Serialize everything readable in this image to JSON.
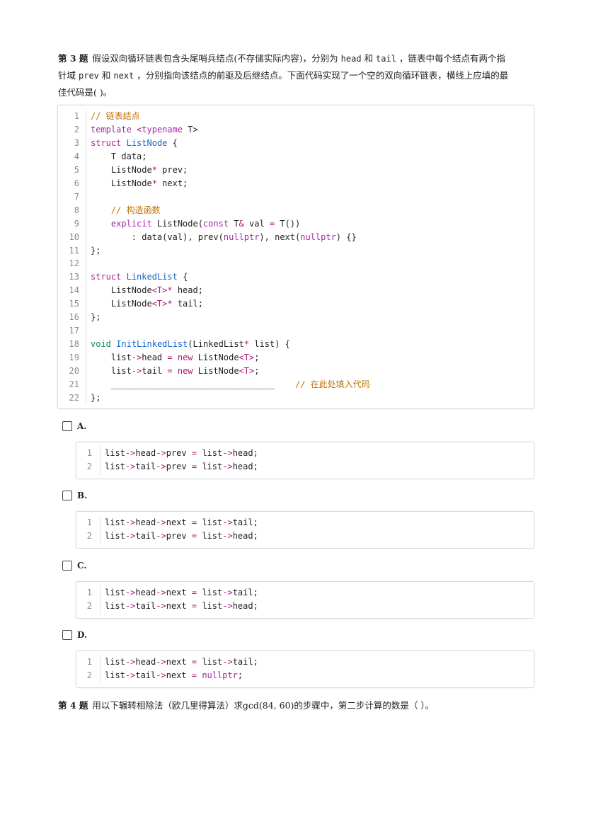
{
  "q3": {
    "num": "第 3 题",
    "line1_a": "假设双向循环链表包含头尾哨兵结点(不存储实际内容)，分别为",
    "line1_head": "head",
    "line1_and": "和",
    "line1_tail": "tail",
    "line1_b": "，链表中每个结点有两个指",
    "line2_a": "针域",
    "line2_prev": "prev",
    "line2_and": "和",
    "line2_next": "next",
    "line2_b": "，分别指向该结点的前驱及后继结点。下面代码实现了一个空的双向循环链表，横线上应填的最",
    "line3": "佳代码是( )。"
  },
  "main_code": {
    "line_numbers": [
      "1",
      "2",
      "3",
      "4",
      "5",
      "6",
      "7",
      "8",
      "9",
      "10",
      "11",
      "12",
      "13",
      "14",
      "15",
      "16",
      "17",
      "18",
      "19",
      "20",
      "21",
      "22"
    ],
    "l1": "// 链表结点",
    "l2_kw1": "template",
    "l2_lt": "<",
    "l2_kw2": "typename",
    "l2_rest": " T>",
    "l3_kw": "struct",
    "l3_name": "ListNode",
    "l3_rest": " {",
    "l4": "    T data;",
    "l5_a": "    ListNode",
    "l5_star": "*",
    "l5_b": " prev;",
    "l6_a": "    ListNode",
    "l6_star": "*",
    "l6_b": " next;",
    "l8": "    // 构造函数",
    "l9_ind": "    ",
    "l9_kw": "explicit",
    "l9_a": " ListNode(",
    "l9_kw2": "const",
    "l9_b": " T",
    "l9_amp": "&",
    "l9_c": " val ",
    "l9_eq": "=",
    "l9_d": " T())",
    "l10_a": "        : data(val), prev(",
    "l10_null1": "nullptr",
    "l10_b": "), next(",
    "l10_null2": "nullptr",
    "l10_c": ") {}",
    "l11": "};",
    "l13_kw": "struct",
    "l13_name": "LinkedList",
    "l13_rest": " {",
    "l14_a": "    ListNode",
    "l14_t": "<T>*",
    "l14_b": " head;",
    "l15_a": "    ListNode",
    "l15_t": "<T>*",
    "l15_b": " tail;",
    "l16": "};",
    "l18_kw": "void",
    "l18_name": "InitLinkedList",
    "l18_a": "(LinkedList",
    "l18_star": "*",
    "l18_b": " list) {",
    "l19_a": "    list",
    "l19_arrow": "->",
    "l19_b": "head ",
    "l19_eq": "=",
    "l19_sp": " ",
    "l19_new": "new",
    "l19_c": " ListNode",
    "l19_t": "<T>",
    "l19_d": ";",
    "l20_a": "    list",
    "l20_arrow": "->",
    "l20_b": "tail ",
    "l20_eq": "=",
    "l20_sp": " ",
    "l20_new": "new",
    "l20_c": " ListNode",
    "l20_t": "<T>",
    "l20_d": ";",
    "l21_blank": "    ________________________________",
    "l21_cmt": "    // 在此处填入代码",
    "l22": "};"
  },
  "options": [
    {
      "label": "A.",
      "ln1": "1",
      "ln2": "2",
      "line1": {
        "a": "list",
        "b": "head",
        "c": "prev",
        "eq": "=",
        "d": "list",
        "e": "head",
        "end": ";"
      },
      "line2": {
        "a": "list",
        "b": "tail",
        "c": "prev",
        "eq": "=",
        "d": "list",
        "e": "head",
        "end": ";"
      }
    },
    {
      "label": "B.",
      "ln1": "1",
      "ln2": "2",
      "line1": {
        "a": "list",
        "b": "head",
        "c": "next",
        "eq": "=",
        "d": "list",
        "e": "tail",
        "end": ";"
      },
      "line2": {
        "a": "list",
        "b": "tail",
        "c": "prev",
        "eq": "=",
        "d": "list",
        "e": "head",
        "end": ";"
      }
    },
    {
      "label": "C.",
      "ln1": "1",
      "ln2": "2",
      "line1": {
        "a": "list",
        "b": "head",
        "c": "next",
        "eq": "=",
        "d": "list",
        "e": "tail",
        "end": ";"
      },
      "line2": {
        "a": "list",
        "b": "tail",
        "c": "next",
        "eq": "=",
        "d": "list",
        "e": "head",
        "end": ";"
      }
    },
    {
      "label": "D.",
      "ln1": "1",
      "ln2": "2",
      "line1": {
        "a": "list",
        "b": "head",
        "c": "next",
        "eq": "=",
        "d": "list",
        "e": "tail",
        "end": ";"
      },
      "line2": {
        "a": "list",
        "b": "tail",
        "c": "next",
        "eq": "=",
        "null": "nullptr",
        "end": ";"
      }
    }
  ],
  "arrow": "->",
  "q4": {
    "num": "第 4 题",
    "text": "用以下辗转相除法（欧几里得算法）求gcd(84, 60)的步骤中，第二步计算的数是（  ）。"
  }
}
